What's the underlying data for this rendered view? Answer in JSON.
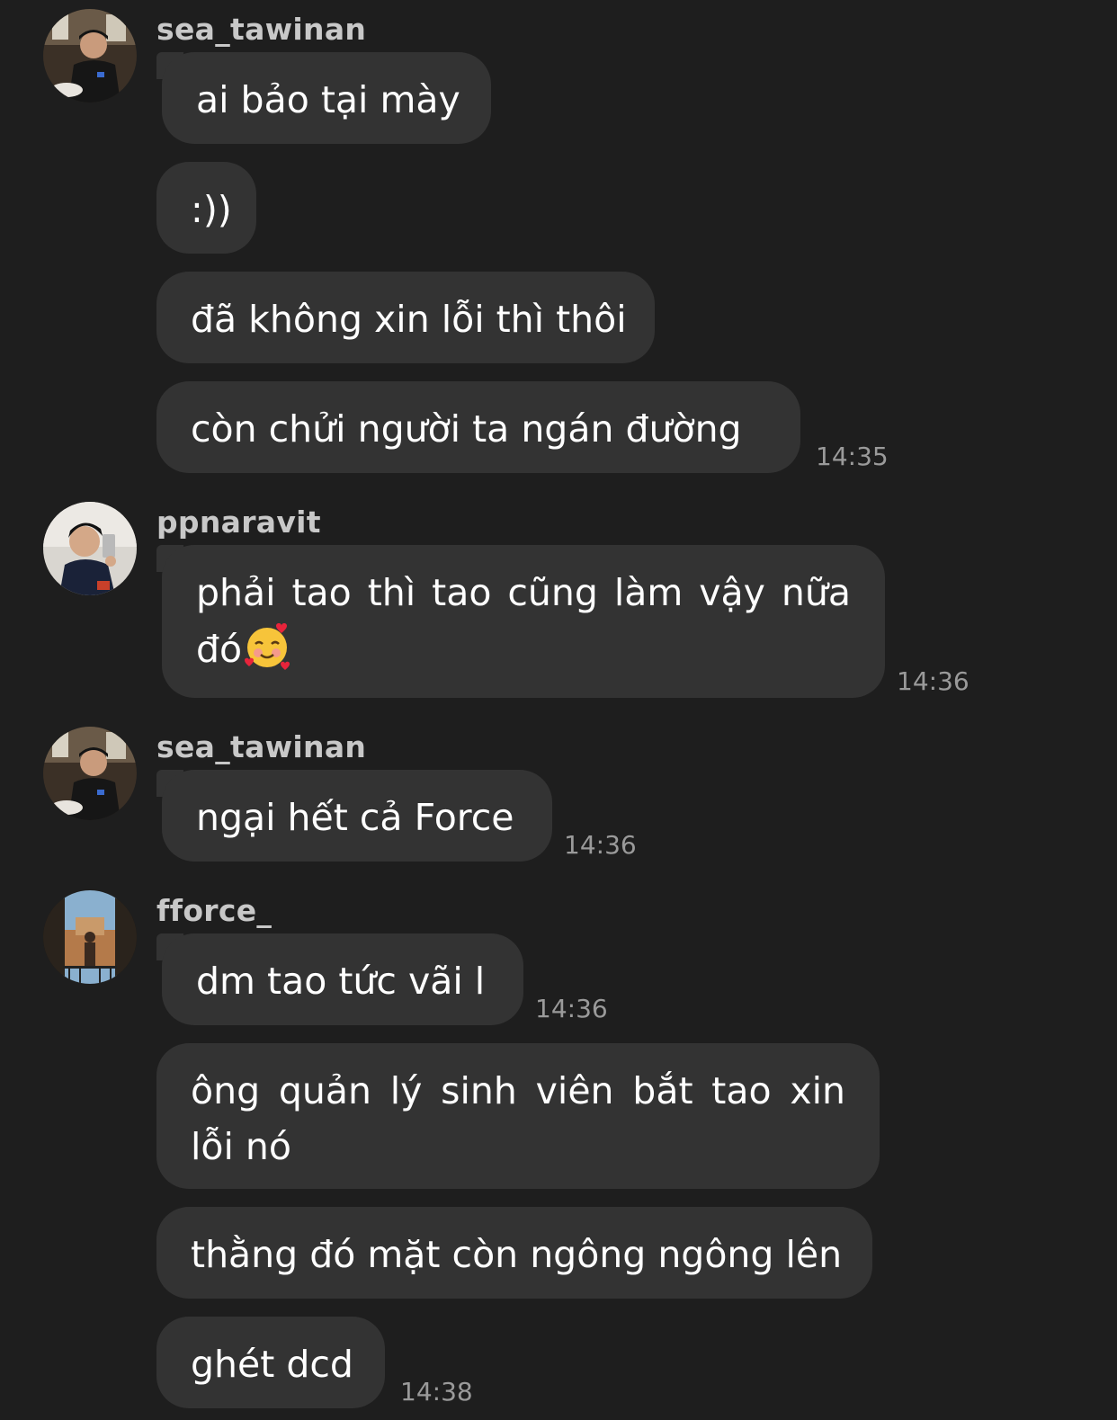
{
  "chat": {
    "groups": [
      {
        "username": "sea_tawinan",
        "avatar_icon": "user-avatar-photo",
        "messages": [
          {
            "text": "ai bảo tại mày"
          },
          {
            "text": ":))"
          },
          {
            "text": "đã không xin lỗi thì thôi"
          },
          {
            "text": "còn chửi người ta ngán đường",
            "time": "14:35"
          }
        ]
      },
      {
        "username": "ppnaravit",
        "avatar_icon": "user-avatar-photo",
        "messages": [
          {
            "text": "phải tao thì tao cũng làm vậy nữa đó",
            "emoji": "smiling-face-with-hearts-emoji",
            "time": "14:36"
          }
        ]
      },
      {
        "username": "sea_tawinan",
        "avatar_icon": "user-avatar-photo",
        "messages": [
          {
            "text": "ngại hết cả Force",
            "time": "14:36"
          }
        ]
      },
      {
        "username": "fforce_",
        "avatar_icon": "user-avatar-photo",
        "messages": [
          {
            "text": "dm tao tức vãi l",
            "time": "14:36"
          },
          {
            "text": "ông quản lý sinh viên bắt tao xin lỗi nó"
          },
          {
            "text": "thằng đó mặt còn ngông ngông lên"
          },
          {
            "text": "ghét dcd",
            "time": "14:38"
          }
        ]
      }
    ]
  },
  "colors": {
    "background": "#1e1e1e",
    "bubble": "#333333",
    "text": "#ffffff",
    "username": "#c8c8c8",
    "timestamp": "#9a9a9a"
  }
}
